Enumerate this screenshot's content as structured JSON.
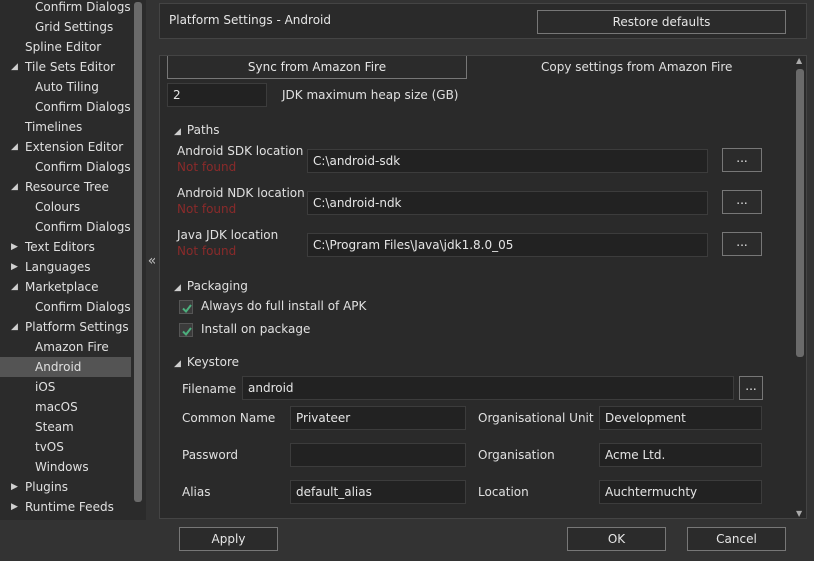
{
  "sidebar": {
    "items": [
      {
        "label": "Confirm Dialogs",
        "level": 2,
        "expandable": false,
        "selected": false
      },
      {
        "label": "Grid Settings",
        "level": 2,
        "expandable": false,
        "selected": false
      },
      {
        "label": "Spline Editor",
        "level": 1,
        "expandable": false,
        "selected": false
      },
      {
        "label": "Tile Sets Editor",
        "level": 1,
        "expandable": true,
        "expanded": true,
        "selected": false
      },
      {
        "label": "Auto Tiling",
        "level": 2,
        "expandable": false,
        "selected": false
      },
      {
        "label": "Confirm Dialogs",
        "level": 2,
        "expandable": false,
        "selected": false
      },
      {
        "label": "Timelines",
        "level": 1,
        "expandable": false,
        "selected": false
      },
      {
        "label": "Extension Editor",
        "level": 1,
        "expandable": true,
        "expanded": true,
        "selected": false
      },
      {
        "label": "Confirm Dialogs",
        "level": 2,
        "expandable": false,
        "selected": false
      },
      {
        "label": "Resource Tree",
        "level": 1,
        "expandable": true,
        "expanded": true,
        "selected": false
      },
      {
        "label": "Colours",
        "level": 2,
        "expandable": false,
        "selected": false
      },
      {
        "label": "Confirm Dialogs",
        "level": 2,
        "expandable": false,
        "selected": false
      },
      {
        "label": "Text Editors",
        "level": 1,
        "expandable": true,
        "expanded": false,
        "selected": false
      },
      {
        "label": "Languages",
        "level": 1,
        "expandable": true,
        "expanded": false,
        "selected": false
      },
      {
        "label": "Marketplace",
        "level": 1,
        "expandable": true,
        "expanded": true,
        "selected": false
      },
      {
        "label": "Confirm Dialogs",
        "level": 2,
        "expandable": false,
        "selected": false
      },
      {
        "label": "Platform Settings",
        "level": 1,
        "expandable": true,
        "expanded": true,
        "selected": false
      },
      {
        "label": "Amazon Fire",
        "level": 2,
        "expandable": false,
        "selected": false
      },
      {
        "label": "Android",
        "level": 2,
        "expandable": false,
        "selected": true
      },
      {
        "label": "iOS",
        "level": 2,
        "expandable": false,
        "selected": false
      },
      {
        "label": "macOS",
        "level": 2,
        "expandable": false,
        "selected": false
      },
      {
        "label": "Steam",
        "level": 2,
        "expandable": false,
        "selected": false
      },
      {
        "label": "tvOS",
        "level": 2,
        "expandable": false,
        "selected": false
      },
      {
        "label": "Windows",
        "level": 2,
        "expandable": false,
        "selected": false
      },
      {
        "label": "Plugins",
        "level": 1,
        "expandable": true,
        "expanded": false,
        "selected": false
      },
      {
        "label": "Runtime Feeds",
        "level": 1,
        "expandable": true,
        "expanded": false,
        "selected": false
      }
    ],
    "collapse_glyph": "«"
  },
  "header": {
    "title": "Platform Settings - Android",
    "restore_label": "Restore defaults"
  },
  "sync": {
    "sync_label": "Sync from Amazon Fire",
    "copy_label": "Copy settings from Amazon Fire"
  },
  "heap": {
    "value": "2",
    "label": "JDK maximum heap size (GB)"
  },
  "paths": {
    "title": "Paths",
    "sdk_label": "Android SDK location",
    "sdk_status": "Not found",
    "sdk_value": "C:\\android-sdk",
    "ndk_label": "Android NDK location",
    "ndk_status": "Not found",
    "ndk_value": "C:\\android-ndk",
    "jdk_label": "Java JDK location",
    "jdk_status": "Not found",
    "jdk_value": "C:\\Program Files\\Java\\jdk1.8.0_05",
    "browse_label": "..."
  },
  "packaging": {
    "title": "Packaging",
    "full_install_label": "Always do full install of APK",
    "full_install_checked": true,
    "install_on_package_label": "Install on package",
    "install_on_package_checked": true
  },
  "keystore": {
    "title": "Keystore",
    "filename_label": "Filename",
    "filename_value": "android",
    "browse_label": "...",
    "common_name_label": "Common Name",
    "common_name_value": "Privateer",
    "org_unit_label": "Organisational Unit",
    "org_unit_value": "Development",
    "password_label": "Password",
    "password_value": "",
    "organisation_label": "Organisation",
    "organisation_value": "Acme Ltd.",
    "alias_label": "Alias",
    "alias_value": "default_alias",
    "location_label": "Location",
    "location_value": "Auchtermuchty"
  },
  "footer": {
    "apply_label": "Apply",
    "ok_label": "OK",
    "cancel_label": "Cancel"
  },
  "colors": {
    "background": "#333333",
    "panel": "#2a2a2a",
    "selected": "#545454",
    "error": "#8a2a2a",
    "check": "#4caf7d"
  }
}
